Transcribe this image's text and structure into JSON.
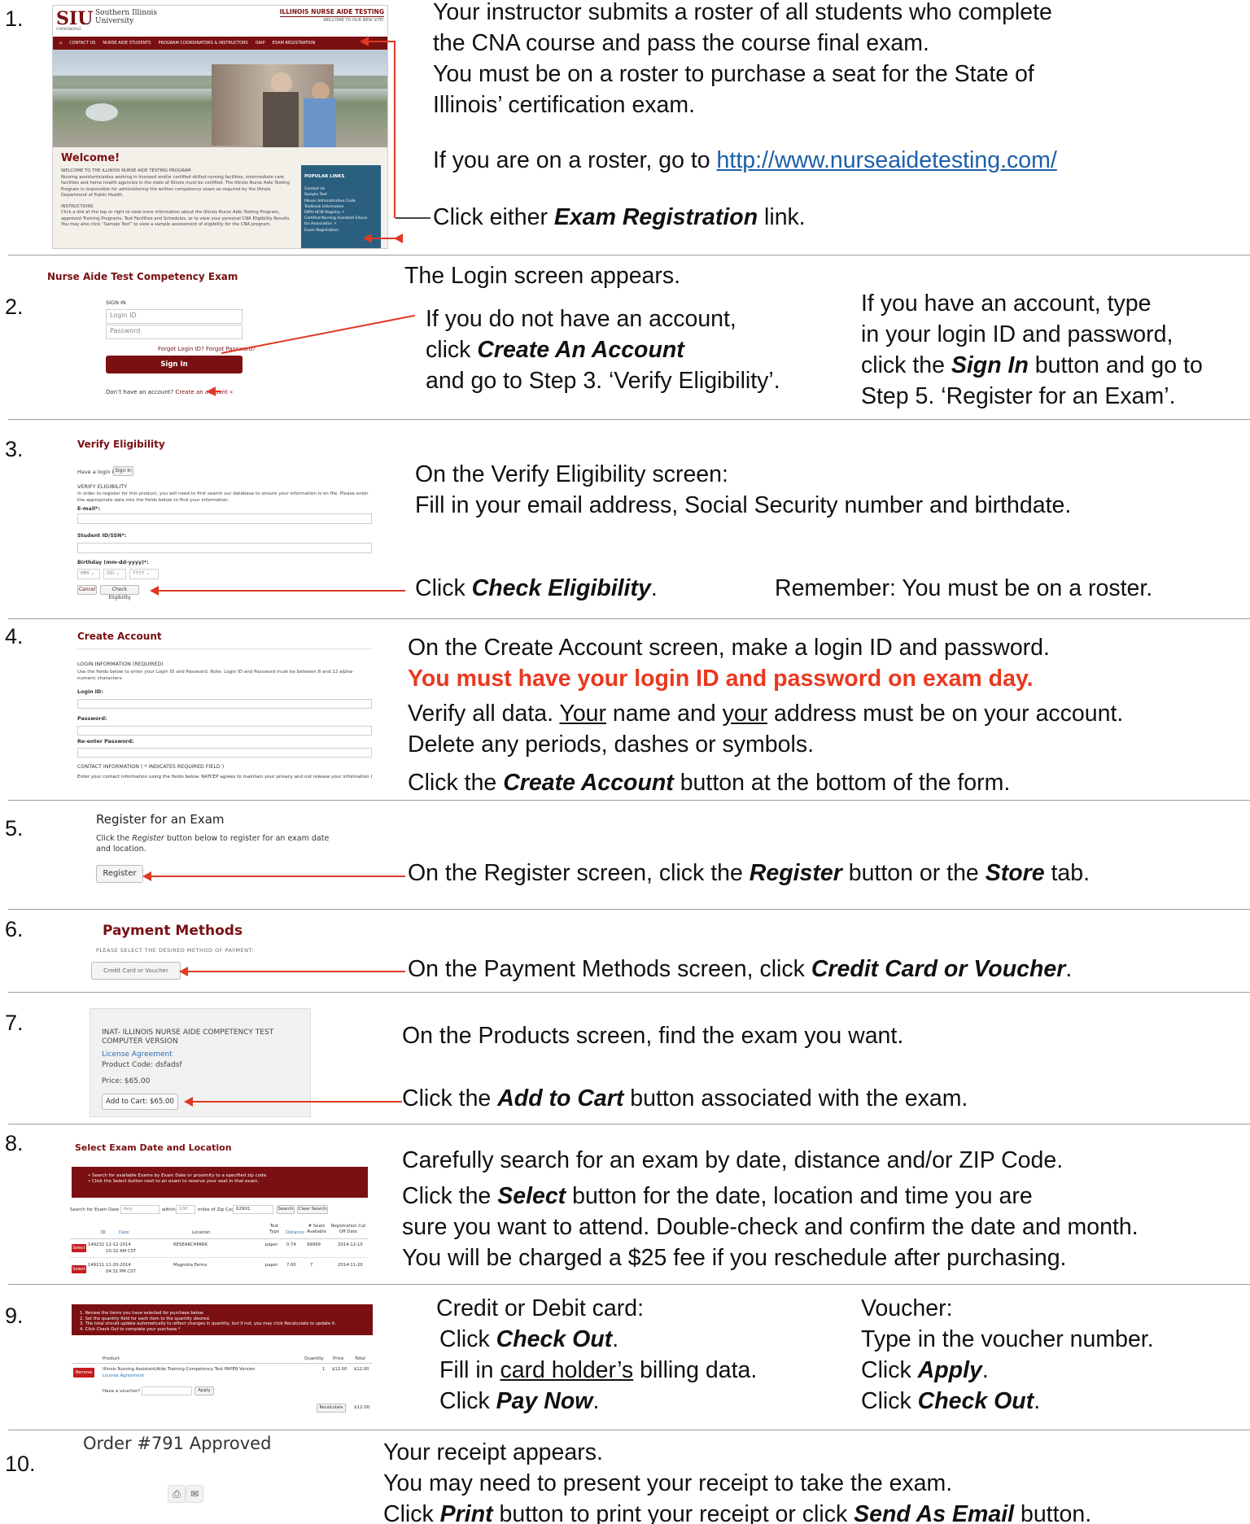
{
  "steps": [
    {
      "n": "1."
    },
    {
      "n": "2."
    },
    {
      "n": "3."
    },
    {
      "n": "4."
    },
    {
      "n": "5."
    },
    {
      "n": "6."
    },
    {
      "n": "7."
    },
    {
      "n": "8."
    },
    {
      "n": "9."
    },
    {
      "n": "10."
    }
  ],
  "s1": {
    "line1": "Your instructor submits a roster of all students who complete",
    "line2": "the CNA course and pass the course final exam.",
    "line3": "You must be on a roster to purchase a seat for the State of",
    "line4": "Illinois’ certification exam.",
    "line5_pre": "If you are on a roster, go to ",
    "url": "http://www.nurseaidetesting.com/",
    "line6_pre": "Click either ",
    "line6_bold": "Exam Registration",
    "line6_post": " link.",
    "shot": {
      "logo": "SIU",
      "uni1": "Southern Illinois",
      "uni2": "University",
      "campus": "CARBONDALE",
      "site_title": "ILLINOIS NURSE AIDE TESTING",
      "site_sub": "WELCOME TO OUR NEW SITE!",
      "nav": [
        "CONTACT US",
        "NURSE AIDE STUDENTS",
        "PROGRAM COORDINATORS & INSTRUCTORS",
        "OIAP",
        "EXAM REGISTRATION"
      ],
      "welcome": "Welcome!",
      "p1": "WELCOME TO THE ILLINOIS NURSE AIDE TESTING PROGRAM",
      "p2": "Nursing assistants/aides working in licensed and/or certified skilled nursing facilities, intermediate care facilities and home health agencies in the state of Illinois must be certified. The Illinois Nurse Aide Testing Program is responsible for administering the written competency exam as required by the Illinois Department of Public Health.",
      "p3": "INSTRUCTIONS",
      "p4": "Click a link at the top or right to view more information about the Illinois Nurse Aide Testing Program, approved Training Programs, Test Facilities and Schedules, or to view your personal CNA Eligibility Results. You may also click “Sample Test” to view a sample assessment of eligibility for the CNA program.",
      "popular": "POPULAR LINKS",
      "links": [
        "Contact Us",
        "Sample Test",
        "Illinois Administrative Code",
        "Textbook Information",
        "IDPH HCW Registry ↗",
        "Certified Nursing Assistant Educa-",
        "tor Association ↗",
        "Exam Registration"
      ]
    }
  },
  "s2": {
    "title": "The Login screen appears.",
    "l1": "If you do not have an account,",
    "l2_pre": "click ",
    "l2_bold": "Create An Account",
    "l3": "and go to Step 3. ‘Verify Eligibility’.",
    "r1": "If you have an account, type",
    "r2": "in your login ID and password,",
    "r3_pre": "click the ",
    "r3_bold": "Sign In",
    "r3_post": " button and go to",
    "r4": "Step 5. ‘Register for an Exam’.",
    "shot": {
      "title": "Nurse Aide Test Competency Exam",
      "signin": "SIGN IN",
      "login_ph": "Login ID",
      "pass_ph": "Password",
      "forgot": "Forgot Login ID?   Forgot Password?",
      "btn": "Sign In",
      "noacct": "Don’t have an account? ",
      "create": "Create an account »"
    }
  },
  "s3": {
    "l1": "On the Verify Eligibility screen:",
    "l2": "Fill in your email address, Social Security number and birthdate.",
    "l3_pre": "Click ",
    "l3_bold": "Check Eligibility",
    "l3_post": ".",
    "remember": "Remember: You must be on a roster.",
    "shot": {
      "title": "Verify Eligibility",
      "have": "Have a login ID?",
      "signin": "Sign In",
      "ve": "VERIFY ELIGIBILITY",
      "desc": "In order to register for this product, you will need to first search our database to ensure your information is on file. Please enter the appropriate data into the fields below to find your information.",
      "email": "E-mail*:",
      "ssn": "Student ID/SSN*:",
      "bday": "Birthday (mm-dd-yyyy)*:",
      "mm": "MM",
      "dd": "DD",
      "yyyy": "YYYY",
      "cancel": "Cancel",
      "check": "Check Eligibility"
    }
  },
  "s4": {
    "l1": "On the Create Account screen, make a login ID and password.",
    "l2": "You must have your login ID and password on exam day.",
    "l3_pre": "Verify all data. ",
    "l3_u1": "Your",
    "l3_mid": " name and ",
    "l3_u2": "your",
    "l3_post": " address must be on your account.",
    "l4": "Delete any periods, dashes or symbols.",
    "l5_pre": "Click the ",
    "l5_bold": "Create Account",
    "l5_post": " button at the bottom of the form.",
    "shot": {
      "title": "Create Account",
      "li": "LOGIN INFORMATION (REQUIRED)",
      "desc": "Use the fields below to enter your Login ID and Password. Note: Login ID and Password must be between 8 and 12 alpha-numeric characters.",
      "login": "Login ID:",
      "pw": "Password:",
      "repw": "Re-enter Password:",
      "ci": "CONTACT INFORMATION ( * INDICATES REQUIRED FIELD )",
      "cdesc": "Enter your contact information using the fields below. NATCEP agrees to maintain your privacy and not release your information to"
    }
  },
  "s5": {
    "l1_pre": "On the Register screen, click the ",
    "l1_b1": "Register",
    "l1_mid": " button or the ",
    "l1_b2": "Store",
    "l1_post": " tab.",
    "shot": {
      "title": "Register for an Exam",
      "d1": "Click the ",
      "d1i": "Register",
      "d1b": " button below to register for an exam date",
      "d2": "and location.",
      "btn": "Register"
    }
  },
  "s6": {
    "l1_pre": "On the Payment Methods screen, click ",
    "l1_bold": "Credit Card or Voucher",
    "l1_post": ".",
    "shot": {
      "title": "Payment Methods",
      "sub": "PLEASE SELECT THE DESIRED METHOD OF PAYMENT:",
      "btn": "Credit Card or Voucher"
    }
  },
  "s7": {
    "l1": "On the Products screen, find the exam you want.",
    "l2_pre": "Click the ",
    "l2_bold": "Add to Cart",
    "l2_post": " button associated with the exam.",
    "shot": {
      "t1": "INAT- ILLINOIS NURSE AIDE COMPETENCY TEST",
      "t2": "COMPUTER VERSION",
      "license": "License Agreement",
      "code": "Product Code: dsfadsf",
      "price": "Price: $65.00",
      "btn": "Add to Cart: $65.00"
    }
  },
  "s8": {
    "l1": "Carefully search for an exam by date, distance and/or ZIP Code.",
    "l2_pre": "Click the ",
    "l2_bold": "Select",
    "l2_post": " button for the date, location and time you are",
    "l3": "sure you want to attend. Double-check and confirm the date and month.",
    "l4": "You will be charged a $25 fee if you reschedule after purchasing.",
    "shot": {
      "title": "Select Exam Date and Location",
      "b1": "• Search for available Exams by Exam Date or proximity to a specified zip code.",
      "b2": "• Click the Select button next to an exam to reserve your seat in that exam.",
      "search_lbl": "Search for Exam Date",
      "any": "Any",
      "within": "within",
      "miles": "100",
      "zip_lbl": "miles of Zip Code:",
      "zip": "62901",
      "search_btn": "Search",
      "clear_btn": "Clear Search",
      "headers": [
        "ID",
        "Date",
        "Location",
        "Test Type",
        "Distance",
        "# Seats Available",
        "Registration Cut Off Date"
      ],
      "rows": [
        {
          "btn": "Select",
          "id": "149232",
          "date": "12-12-2014",
          "time": "10:32 AM CST",
          "loc": "RESEARCHPARK",
          "type": "paper",
          "dist": "0.74",
          "seats": "99999",
          "cut": "2014-12-10"
        },
        {
          "btn": "Select",
          "id": "149211",
          "date": "11-20-2014",
          "time": "04:31 PM CST",
          "loc": "Magnolia Farms",
          "type": "paper",
          "dist": "7.00",
          "seats": "7",
          "cut": "2014-11-20"
        }
      ]
    }
  },
  "s9": {
    "c1": "Credit or Debit card:",
    "c2_pre": "Click ",
    "c2_bold": "Check Out",
    "c2_post": ".",
    "c3_pre": "Fill in ",
    "c3_u": "card holder’s",
    "c3_post": " billing data.",
    "c4_pre": "Click ",
    "c4_bold": "Pay Now",
    "c4_post": ".",
    "v1": "Voucher:",
    "v2": "Type in the voucher number.",
    "v3_pre": "Click ",
    "v3_bold": "Apply",
    "v3_post": ".",
    "v4_pre": "Click ",
    "v4_bold": "Check Out",
    "v4_post": ".",
    "shot": {
      "i1": "1. Review the items you have selected for purchase below.",
      "i2": "2. Set the quantity field for each item to the quantity desired.",
      "i3": "3. The total should update automatically to reflect changes in quantity, but if not, you may click Recalculate to update it.",
      "i4": "4. Click Check Out to complete your purchase.*",
      "h_product": "Product",
      "h_qty": "Quantity",
      "h_price": "Price",
      "h_total": "Total",
      "remove": "Remove",
      "product": "Illinois Nursing Assistant/Aide Training Competency Test PAPER Version",
      "license": "License Agreement",
      "qty": "1",
      "price": "$12.00",
      "total": "$12.00",
      "voucher": "Have a voucher?",
      "apply": "Apply",
      "recalc": "Recalculate",
      "grand": "$12.00"
    }
  },
  "s10": {
    "l1": "Your receipt appears.",
    "l2": "You may need to present your receipt to take the exam.",
    "l3_pre": "Click ",
    "l3_b1": "Print",
    "l3_mid": " button to print your receipt or click ",
    "l3_b2": "Send As Email",
    "l3_post": " button.",
    "shot": {
      "order": "Order #791 Approved",
      "print_icon": "printer-icon",
      "email_icon": "envelope-icon"
    }
  },
  "colors": {
    "maroon": "#7a1012",
    "arrow": "#e03a24",
    "link": "#1b5fa8",
    "highlight": "#e8391f"
  }
}
